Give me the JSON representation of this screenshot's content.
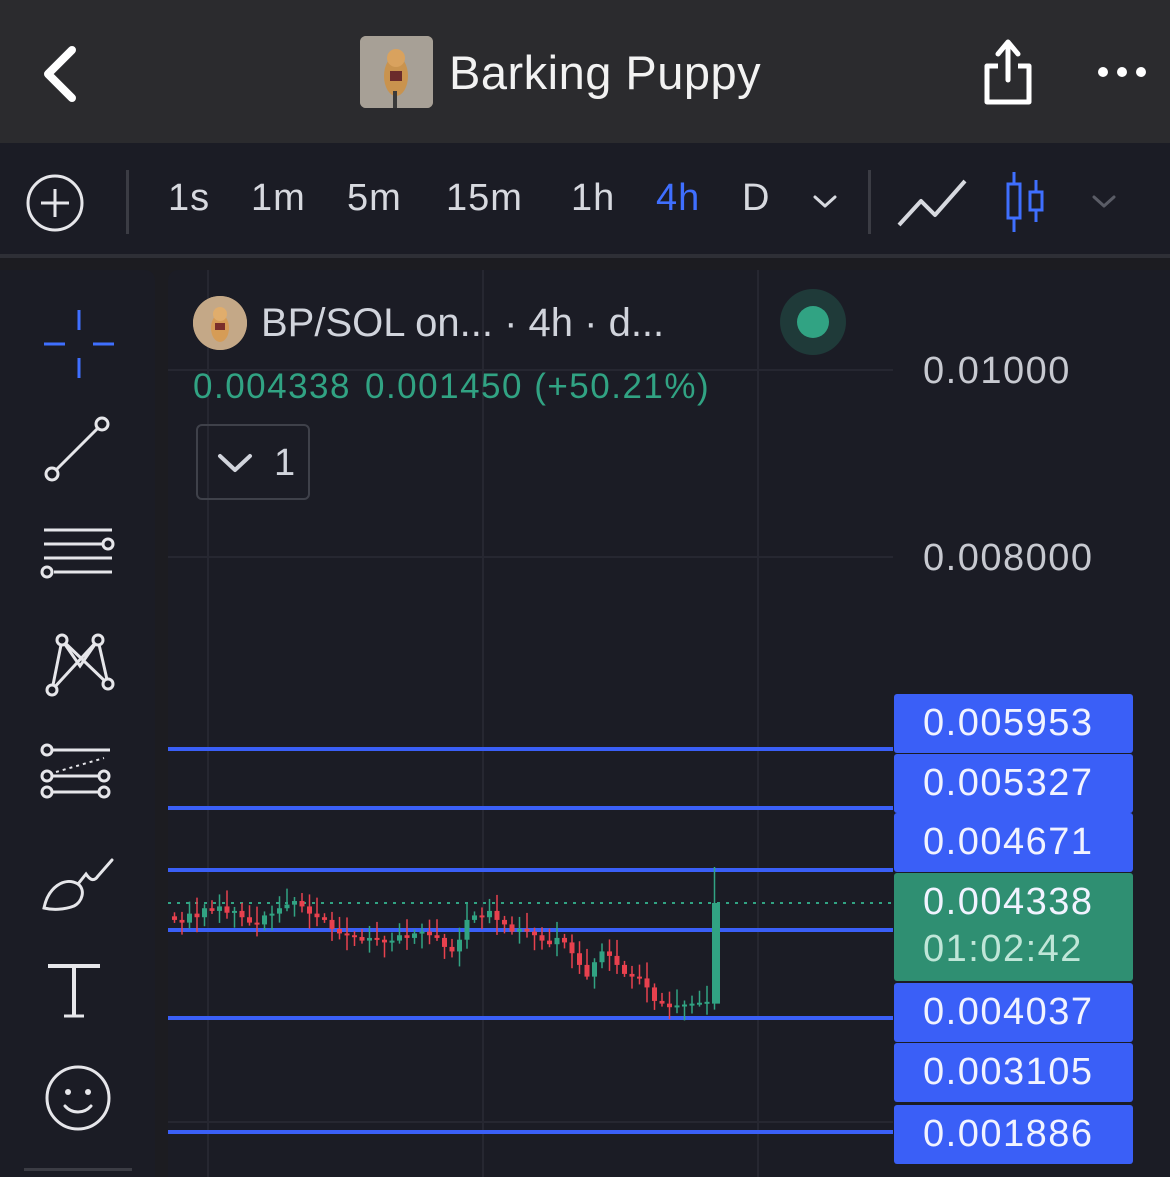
{
  "header": {
    "title": "Barking Puppy"
  },
  "toolbar": {
    "timeframes": [
      "1s",
      "1m",
      "5m",
      "15m",
      "1h",
      "4h",
      "D"
    ],
    "active_timeframe": "4h"
  },
  "left_tools": [
    "crosshair-icon",
    "trend-line-icon",
    "horizontal-lines-icon",
    "pattern-icon",
    "forecast-icon",
    "brush-icon",
    "text-icon",
    "emoji-icon"
  ],
  "legend": {
    "symbol": "BP/SOL on...",
    "interval": " · 4h · d...",
    "close": "0.004338",
    "change": "0.001450 (+50.21%)",
    "indicators_count": "1"
  },
  "colors": {
    "up": "#31a383",
    "down": "#e8414e",
    "horizontal_line": "#3a5ff7",
    "accent": "#3f6fff"
  },
  "axis": {
    "labels": [
      "0.01000",
      "0.008000"
    ]
  },
  "price_tags": {
    "l1": "0.005953",
    "l2": "0.005327",
    "l3": "0.004671",
    "current": "0.004338",
    "timer": "01:02:42",
    "l4": "0.004037",
    "l5": "0.003105",
    "l6": "0.001886"
  },
  "chart_data": {
    "type": "candlestick",
    "title": "BP/SOL · 4h",
    "y_axis_ticks": [
      0.01,
      0.008
    ],
    "horizontal_lines": [
      0.005953,
      0.005327,
      0.004671,
      0.004037,
      0.003105,
      0.001886
    ],
    "last_price": 0.004338,
    "change": 0.00145,
    "change_percent": 50.21,
    "close_series": [
      0.00415,
      0.00412,
      0.00422,
      0.00418,
      0.00428,
      0.00425,
      0.0043,
      0.00423,
      0.00425,
      0.00418,
      0.00412,
      0.0041,
      0.0042,
      0.00422,
      0.00428,
      0.00432,
      0.00436,
      0.0043,
      0.00422,
      0.00418,
      0.00415,
      0.00405,
      0.004,
      0.00398,
      0.00396,
      0.00392,
      0.00395,
      0.00393,
      0.0039,
      0.00392,
      0.00398,
      0.00395,
      0.004,
      0.00402,
      0.00398,
      0.00395,
      0.00385,
      0.0038,
      0.00393,
      0.00415,
      0.0042,
      0.00418,
      0.00425,
      0.00415,
      0.0041,
      0.00402,
      0.00405,
      0.00402,
      0.00398,
      0.00392,
      0.00388,
      0.00395,
      0.0039,
      0.00378,
      0.00365,
      0.00352,
      0.00368,
      0.0038,
      0.00375,
      0.00365,
      0.00355,
      0.00352,
      0.0035,
      0.0034,
      0.00325,
      0.00322,
      0.00318,
      0.0032,
      0.00321,
      0.00322,
      0.00323,
      0.00324,
      0.004338
    ]
  }
}
